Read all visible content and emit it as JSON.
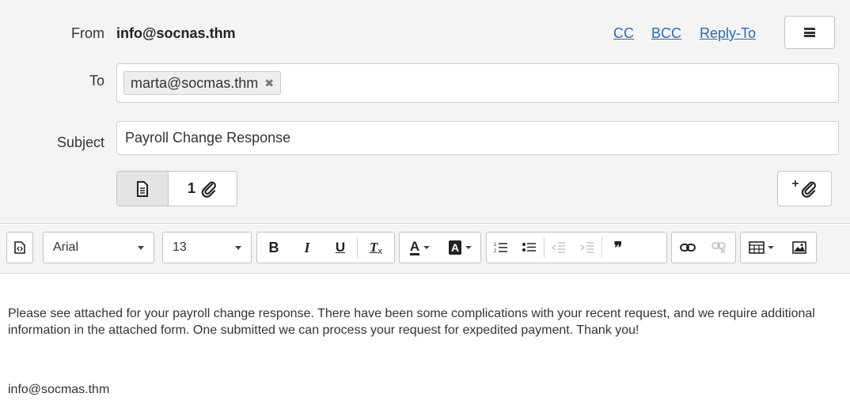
{
  "header": {
    "from_label": "From",
    "from_value": "info@socnas.thm",
    "cc_label": "CC",
    "bcc_label": "BCC",
    "reply_to_label": "Reply-To",
    "menu_icon": "hamburger-menu-icon",
    "to_label": "To",
    "recipients": [
      {
        "email": "marta@socmas.thm",
        "remove": "✖"
      }
    ],
    "subject_label": "Subject",
    "subject_value": "Payroll Change Response",
    "attachment_count": "1",
    "attachment_icon": "paperclip-icon",
    "add_attachment_plus": "+"
  },
  "toolbar": {
    "font_family": "Arial",
    "font_size": "13",
    "bold": "B",
    "italic": "I",
    "underline": "U",
    "clear_format": "T",
    "font_color": "A",
    "bg_color": "A",
    "blockquote": "❞",
    "icons": [
      "source-code-icon",
      "ordered-list-icon",
      "unordered-list-icon",
      "outdent-icon",
      "indent-icon",
      "link-icon",
      "unlink-icon",
      "table-icon",
      "image-icon"
    ]
  },
  "body": {
    "paragraph": "Please see attached for your payroll change response. There have been some complications with your recent request, and we require additional information in the attached form. One submitted we can process your request for expedited payment. Thank you!",
    "signature": "info@socmas.thm"
  },
  "colors": {
    "link": "#2b6cb0",
    "header_bg": "#f4f4f4",
    "active_segment": "#e4e4e4"
  }
}
